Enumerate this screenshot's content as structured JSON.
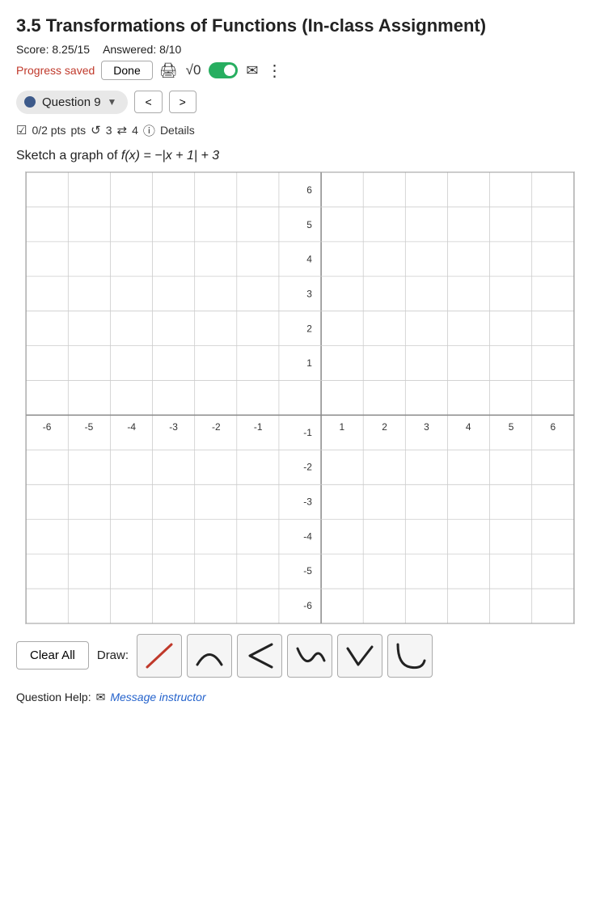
{
  "page": {
    "title": "3.5 Transformations of Functions (In-class Assignment)",
    "score": "Score: 8.25/15",
    "answered": "Answered: 8/10",
    "progress_saved": "Progress saved",
    "done_label": "Done",
    "question_label": "Question 9",
    "question_meta": "0/2 pts",
    "retries": "3",
    "resubmits": "4",
    "details_label": "Details",
    "question_text": "Sketch a graph of",
    "function_expr": "f(x) = −|x + 1| + 3",
    "clear_all_label": "Clear All",
    "draw_label": "Draw:",
    "question_help_label": "Question Help:",
    "message_instructor_label": "Message instructor",
    "toolbar": {
      "icons": [
        "print-icon",
        "sqrt-icon",
        "toggle-icon",
        "mail-icon",
        "more-icon"
      ]
    },
    "graph": {
      "x_min": -6,
      "x_max": 6,
      "y_min": -6,
      "y_max": 6,
      "x_labels": [
        "-6",
        "-5",
        "-4",
        "-3",
        "-2",
        "-1",
        "1",
        "2",
        "3",
        "4",
        "5",
        "6"
      ],
      "y_labels": [
        "6",
        "5",
        "4",
        "3",
        "2",
        "1",
        "-1",
        "-2",
        "-3",
        "-4",
        "-5",
        "-6"
      ]
    },
    "draw_tools": [
      {
        "name": "line-tool",
        "shape": "line"
      },
      {
        "name": "arch-tool",
        "shape": "arch"
      },
      {
        "name": "less-than-tool",
        "shape": "less-than"
      },
      {
        "name": "curve-tool",
        "shape": "curve"
      },
      {
        "name": "check-tool",
        "shape": "check"
      },
      {
        "name": "hook-tool",
        "shape": "hook"
      }
    ]
  }
}
